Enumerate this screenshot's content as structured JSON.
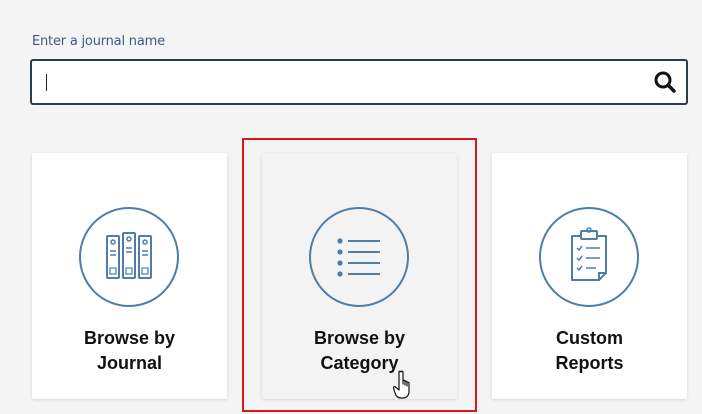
{
  "search": {
    "label": "Enter a journal name",
    "value": "",
    "placeholder": ""
  },
  "icons": {
    "search": "search-icon",
    "journal": "binders-icon",
    "category": "list-icon",
    "reports": "clipboard-icon",
    "cursor": "hand-pointer-icon"
  },
  "cards": [
    {
      "label": "Browse by\nJournal"
    },
    {
      "label": "Browse by\nCategory"
    },
    {
      "label": "Custom\nReports"
    }
  ],
  "colors": {
    "label_text": "#3d5a80",
    "icon_stroke": "#4d7ea8",
    "highlight": "#d71920",
    "input_border": "#2f3b46"
  }
}
